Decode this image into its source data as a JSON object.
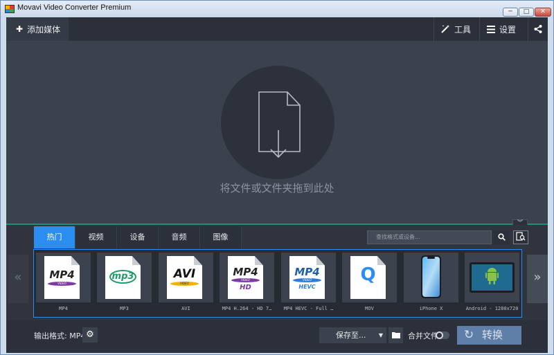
{
  "window": {
    "title": "Movavi Video Converter Premium",
    "min_glyph": "─",
    "max_glyph": "□",
    "close_glyph": "✕"
  },
  "toolbar": {
    "add_media_label": "添加媒体",
    "tools_label": "工具",
    "settings_label": "设置"
  },
  "dropzone": {
    "hint": "将文件或文件夹拖到此处"
  },
  "formats": {
    "tabs": [
      "热门",
      "视频",
      "设备",
      "音频",
      "图像"
    ],
    "active_tab": "热门",
    "search_placeholder": "查找格式或设备...",
    "items": [
      {
        "name": "MP4",
        "logo": "MP4",
        "band": "VIDEO"
      },
      {
        "name": "MP3",
        "logo": "mp3"
      },
      {
        "name": "AVI",
        "logo": "AVI",
        "band": "VIDEO"
      },
      {
        "name": "MP4 H.264 - HD 7…",
        "logo": "MP4",
        "band": "VIDEO",
        "sub": "HD"
      },
      {
        "name": "MP4 HEVC - Full …",
        "logo": "MP4",
        "band": "VIDEO",
        "sub": "HEVC"
      },
      {
        "name": "MOV",
        "logo": "Q"
      },
      {
        "name": "iPhone X",
        "icon": "iphone-icon"
      },
      {
        "name": "Android - 1280x720",
        "icon": "android-tablet-icon"
      }
    ]
  },
  "bottom": {
    "output_format_label": "输出格式: MP4",
    "save_to_label": "保存至...",
    "merge_label": "合并文件",
    "merge_enabled": false,
    "convert_label": "转换"
  },
  "colors": {
    "accent": "#2b8df0",
    "panel": "#2b303b",
    "background": "#3b414d",
    "divider": "#1f8f78"
  }
}
